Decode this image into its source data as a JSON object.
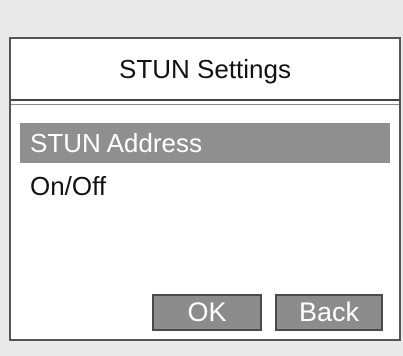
{
  "screen": {
    "title": "STUN Settings",
    "menu_items": [
      {
        "label": "STUN Address",
        "selected": true
      },
      {
        "label": "On/Off",
        "selected": false
      }
    ],
    "softkeys": {
      "ok": "OK",
      "back": "Back"
    }
  }
}
